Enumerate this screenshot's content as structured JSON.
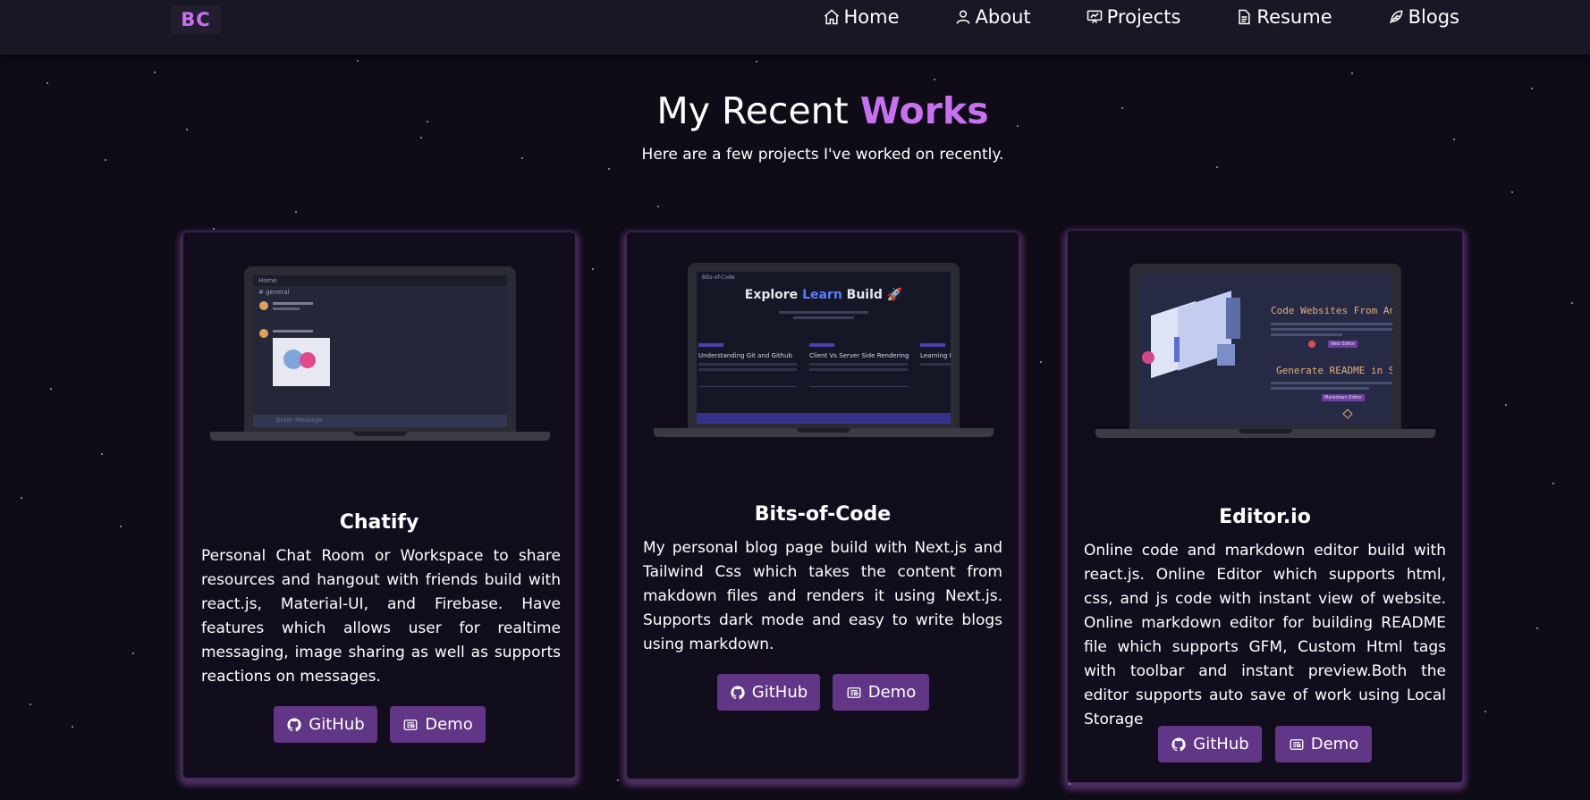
{
  "nav": {
    "logo": "BC",
    "items": [
      {
        "label": "Home",
        "icon": "home-icon"
      },
      {
        "label": "About",
        "icon": "user-icon"
      },
      {
        "label": "Projects",
        "icon": "projects-icon"
      },
      {
        "label": "Resume",
        "icon": "document-icon"
      },
      {
        "label": "Blogs",
        "icon": "feather-icon"
      }
    ]
  },
  "heading": {
    "text": "My Recent ",
    "accent": "Works",
    "subtitle": "Here are a few projects I've worked on recently."
  },
  "colors": {
    "accent": "#c770f0",
    "button": "#623686",
    "background": "#0f0b17",
    "navbar": "#191726"
  },
  "projects": [
    {
      "title": "Chatify",
      "description": "Personal Chat Room or Workspace to share resources and hangout with friends build with react.js, Material-UI, and Firebase. Have features which allows user for realtime messaging, image sharing as well as supports reactions on messages.",
      "github_label": "GitHub",
      "demo_label": "Demo",
      "preview": {
        "header": "Home",
        "channel": "# general",
        "input": "Enter Message"
      }
    },
    {
      "title": "Bits-of-Code",
      "description": "My personal blog page build with Next.js and Tailwind Css which takes the content from makdown files and renders it using Next.js. Supports dark mode and easy to write blogs using markdown.",
      "github_label": "GitHub",
      "demo_label": "Demo",
      "preview": {
        "brand": "Bits-of-Code",
        "hero_a": "Explore ",
        "hero_b": "Learn",
        "hero_c": " Build 🚀",
        "posts": [
          "Understanding Git and Github",
          "Client Vs Server Side Rendering",
          "Learning Re"
        ]
      }
    },
    {
      "title": "Editor.io",
      "description": "Online code and markdown editor build with react.js. Online Editor which supports html, css, and js code with instant view of website. Online markdown editor for building README file which supports GFM, Custom Html tags with toolbar and instant preview.Both the editor supports auto save of work using Local Storage",
      "github_label": "GitHub",
      "demo_label": "Demo",
      "preview": {
        "line1": "Code Websites From Any W",
        "btn1": "Web Editor",
        "line2": "Generate README in Seco",
        "btn2": "Markdown Editor"
      }
    }
  ]
}
